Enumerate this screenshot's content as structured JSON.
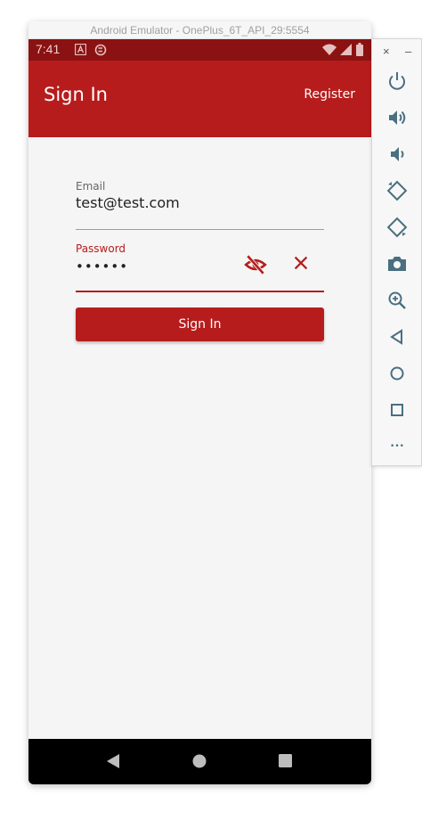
{
  "emulator": {
    "title": "Android Emulator - OnePlus_6T_API_29:5554"
  },
  "status_bar": {
    "time": "7:41"
  },
  "app_bar": {
    "title": "Sign In",
    "register_label": "Register"
  },
  "form": {
    "email_label": "Email",
    "email_value": "test@test.com",
    "password_label": "Password",
    "password_value": "••••••",
    "signin_label": "Sign In"
  },
  "colors": {
    "primary": "#b71c1c",
    "status_bar": "#8b1212",
    "background": "#f5f5f5"
  },
  "toolbar": {
    "close_glyph": "×",
    "minimize_glyph": "–",
    "more_glyph": "•••"
  }
}
